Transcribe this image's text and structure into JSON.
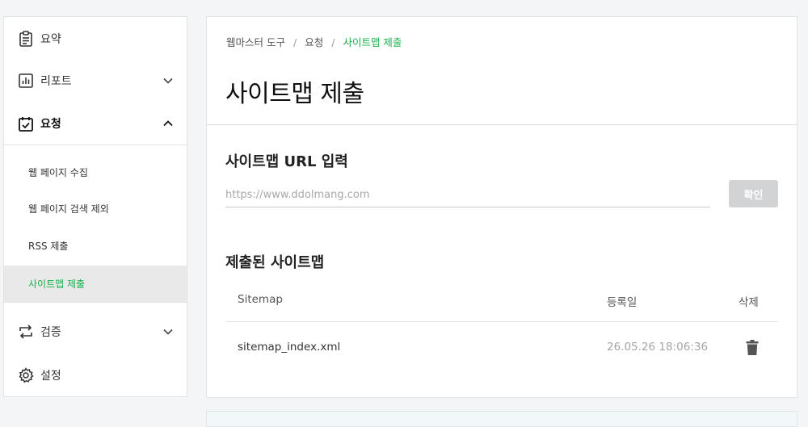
{
  "sidebar": {
    "items": [
      {
        "label": "요약",
        "icon": "clipboard-icon"
      },
      {
        "label": "리포트",
        "icon": "bar-chart-icon",
        "expanded": false
      },
      {
        "label": "요청",
        "icon": "calendar-check-icon",
        "expanded": true
      },
      {
        "label": "검증",
        "icon": "repeat-icon",
        "expanded": false
      },
      {
        "label": "설정",
        "icon": "gear-icon"
      }
    ],
    "sub_items": [
      {
        "label": "웹 페이지 수집"
      },
      {
        "label": "웹 페이지 검색 제외"
      },
      {
        "label": "RSS 제출"
      },
      {
        "label": "사이트맵 제출",
        "active": true
      }
    ]
  },
  "breadcrumb": {
    "items": [
      "웹마스터 도구",
      "요청",
      "사이트맵 제출"
    ],
    "separator": "/"
  },
  "page": {
    "title": "사이트맵 제출"
  },
  "url_section": {
    "title": "사이트맵 URL 입력",
    "placeholder": "https://www.ddolmang.com",
    "value": "",
    "button_label": "확인"
  },
  "submitted": {
    "title": "제출된 사이트맵",
    "columns": [
      "Sitemap",
      "등록일",
      "삭제"
    ],
    "rows": [
      {
        "sitemap": "sitemap_index.xml",
        "date": "26.05.26 18:06:36",
        "delete_icon": "trash-icon"
      }
    ]
  },
  "colors": {
    "accent": "#19b04a",
    "button_disabled": "#d2d3d5",
    "active_bg": "#e9e9ea"
  }
}
